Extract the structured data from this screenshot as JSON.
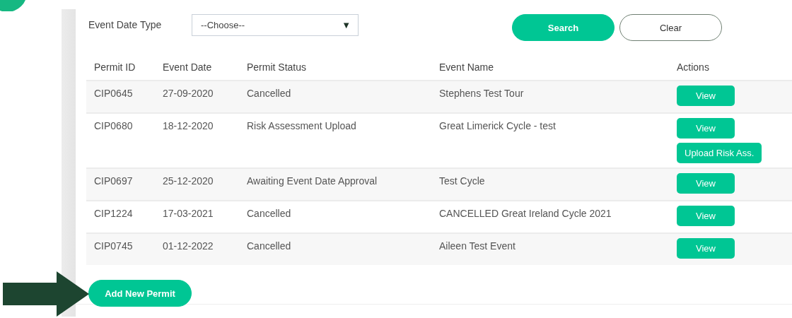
{
  "filter": {
    "label": "Event Date Type",
    "select": {
      "value": "--Choose--",
      "arrow": "▼"
    },
    "buttons": [
      {
        "label": "Search",
        "kind": "primary"
      },
      {
        "label": "Clear",
        "kind": "outline"
      }
    ]
  },
  "table": {
    "columns": [
      "Permit ID",
      "Event Date",
      "Permit Status",
      "Event Name",
      "Actions"
    ],
    "rows": [
      {
        "permit_id": "CIP0645",
        "event_date": "27-09-2020",
        "permit_status": "Cancelled",
        "event_name": "Stephens Test Tour",
        "actions": [
          "View"
        ]
      },
      {
        "permit_id": "CIP0680",
        "event_date": "18-12-2020",
        "permit_status": "Risk Assessment Upload",
        "event_name": "Great Limerick Cycle - test",
        "actions": [
          "View",
          "Upload Risk Ass."
        ]
      },
      {
        "permit_id": "CIP0697",
        "event_date": "25-12-2020",
        "permit_status": "Awaiting Event Date Approval",
        "event_name": "Test Cycle",
        "actions": [
          "View"
        ]
      },
      {
        "permit_id": "CIP1224",
        "event_date": "17-03-2021",
        "permit_status": "Cancelled",
        "event_name": "CANCELLED Great Ireland Cycle 2021",
        "actions": [
          "View"
        ]
      },
      {
        "permit_id": "CIP0745",
        "event_date": "01-12-2022",
        "permit_status": "Cancelled",
        "event_name": "Aileen Test Event",
        "actions": [
          "View"
        ]
      }
    ]
  },
  "add_button": {
    "label": "Add New Permit"
  }
}
